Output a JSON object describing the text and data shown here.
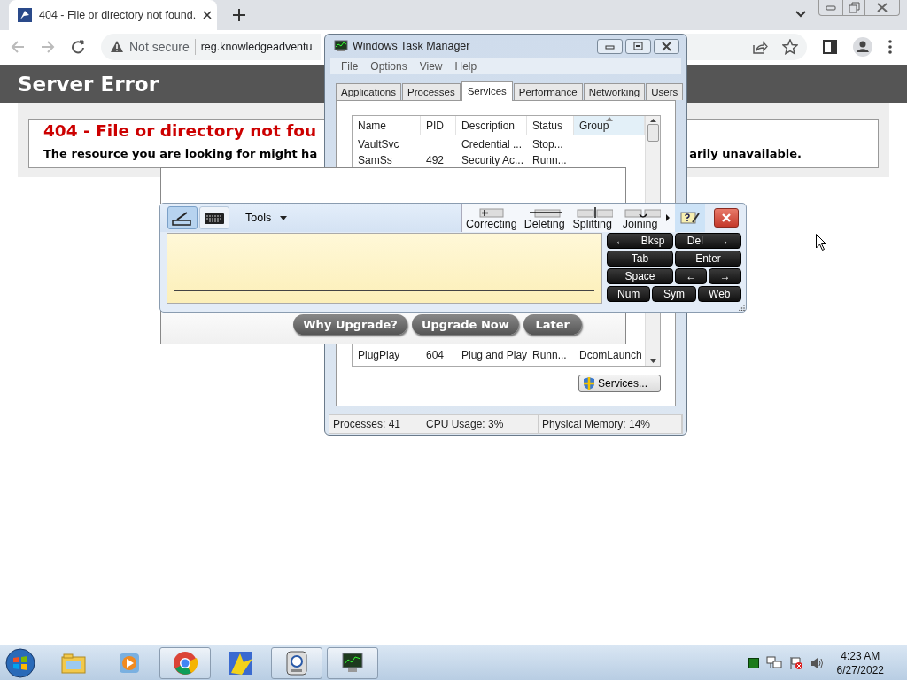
{
  "browser": {
    "tab": {
      "title": "404 - File or directory not found."
    },
    "address": {
      "security": "Not secure",
      "url": "reg.knowledgeadventu"
    }
  },
  "page": {
    "header": "Server Error",
    "error_title": "404 - File or directory not fou",
    "message_left": "The resource you are looking for might ha",
    "message_right": "arily unavailable."
  },
  "task_manager": {
    "title": "Windows Task Manager",
    "menu": [
      "File",
      "Options",
      "View",
      "Help"
    ],
    "tabs": [
      {
        "label": "Applications",
        "selected": false
      },
      {
        "label": "Processes",
        "selected": false
      },
      {
        "label": "Services",
        "selected": true
      },
      {
        "label": "Performance",
        "selected": false
      },
      {
        "label": "Networking",
        "selected": false
      },
      {
        "label": "Users",
        "selected": false
      }
    ],
    "columns": [
      {
        "label": "Name",
        "sorted": false
      },
      {
        "label": "PID",
        "sorted": false
      },
      {
        "label": "Description",
        "sorted": false
      },
      {
        "label": "Status",
        "sorted": false
      },
      {
        "label": "Group",
        "sorted": true
      }
    ],
    "rows": [
      {
        "name": "VaultSvc",
        "pid": "",
        "description": "Credential ...",
        "status": "Stop...",
        "group": ""
      },
      {
        "name": "SamSs",
        "pid": "492",
        "description": "Security Ac...",
        "status": "Runn...",
        "group": ""
      },
      {
        "name": "PlugPlay",
        "pid": "604",
        "description": "Plug and Play",
        "status": "Runn...",
        "group": "DcomLaunch"
      }
    ],
    "services_button": "Services...",
    "status_bar": [
      "Processes: 41",
      "CPU Usage: 3%",
      "Physical Memory: 14%"
    ]
  },
  "upgrade_dialog": {
    "buttons": [
      "Why Upgrade?",
      "Upgrade Now",
      "Later"
    ]
  },
  "input_panel": {
    "modes": [
      {
        "kind": "pen",
        "selected": true
      },
      {
        "kind": "keyboard",
        "selected": false
      }
    ],
    "tools": "Tools",
    "gestures": [
      {
        "kind": "correct",
        "label": "Correcting"
      },
      {
        "kind": "delete",
        "label": "Deleting"
      },
      {
        "kind": "split",
        "label": "Splitting"
      },
      {
        "kind": "join",
        "label": "Joining"
      }
    ],
    "keys": [
      "← Bksp",
      "Del →",
      "Tab",
      "Enter",
      "Space",
      "←",
      "→",
      "Num",
      "Sym",
      "Web"
    ]
  },
  "taskbar": {
    "apps": [
      {
        "kind": "explorer",
        "active": false
      },
      {
        "kind": "media",
        "active": false
      },
      {
        "kind": "chrome",
        "active": true
      },
      {
        "kind": "paint",
        "active": false
      },
      {
        "kind": "quicktime",
        "active": true
      },
      {
        "kind": "taskmgr",
        "active": true
      }
    ],
    "time": "4:23 AM",
    "date": "6/27/2022"
  }
}
